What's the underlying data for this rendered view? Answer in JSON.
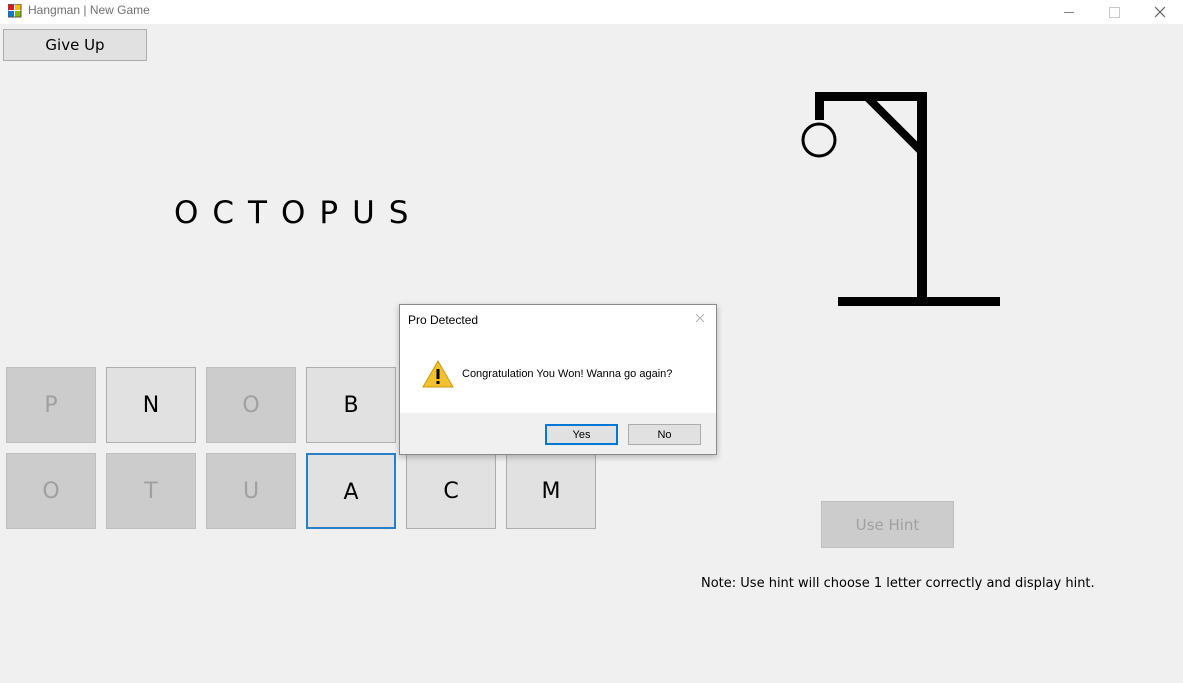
{
  "window": {
    "title": "Hangman | New Game"
  },
  "game": {
    "give_up_label": "Give Up",
    "word_display": "OCTOPUS",
    "hint_label": "Use Hint",
    "note": "Note:  Use hint will choose 1 letter correctly and display hint.",
    "letters_row1": [
      {
        "letter": "P",
        "state": "disabled"
      },
      {
        "letter": "N",
        "state": "enabled"
      },
      {
        "letter": "O",
        "state": "disabled"
      },
      {
        "letter": "B",
        "state": "enabled"
      }
    ],
    "letters_row2": [
      {
        "letter": "O",
        "state": "disabled"
      },
      {
        "letter": "T",
        "state": "disabled"
      },
      {
        "letter": "U",
        "state": "disabled"
      },
      {
        "letter": "A",
        "state": "focused"
      },
      {
        "letter": "C",
        "state": "enabled"
      },
      {
        "letter": "M",
        "state": "enabled"
      }
    ]
  },
  "dialog": {
    "title": "Pro Detected",
    "message": "Congratulation You Won! Wanna go again?",
    "icon": "warning-icon",
    "yes_label": "Yes",
    "no_label": "No"
  },
  "colors": {
    "window_bg": "#f0f0f0",
    "focus_border": "#0078d7",
    "warning_yellow": "#f2c12e"
  }
}
